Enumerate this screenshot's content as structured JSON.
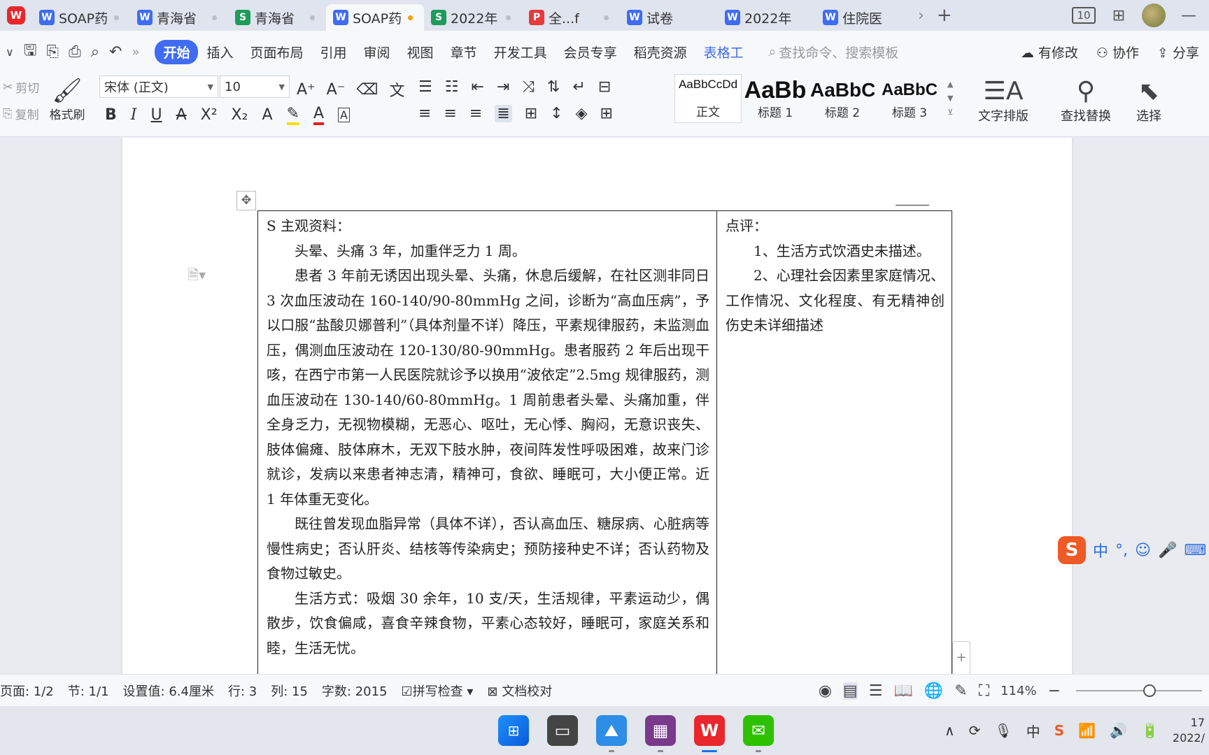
{
  "tabs": [
    {
      "label": "SOAP药",
      "kind": "W",
      "color": "#3f6cf2",
      "active": false
    },
    {
      "label": "青海省",
      "kind": "W",
      "color": "#3f6cf2",
      "active": false
    },
    {
      "label": "青海省",
      "kind": "S",
      "color": "#1d9c5a",
      "active": false
    },
    {
      "label": "SOAP药",
      "kind": "W",
      "color": "#3f6cf2",
      "active": true
    },
    {
      "label": "2022年",
      "kind": "S",
      "color": "#1d9c5a",
      "active": false
    },
    {
      "label": "全...f",
      "kind": "P",
      "color": "#e8393c",
      "active": false
    },
    {
      "label": "试卷",
      "kind": "W",
      "color": "#3f6cf2",
      "active": false
    },
    {
      "label": "2022年",
      "kind": "W",
      "color": "#3f6cf2",
      "active": false
    },
    {
      "label": "住院医",
      "kind": "W",
      "color": "#3f6cf2",
      "active": false
    }
  ],
  "window": {
    "layout_label": "10"
  },
  "menu": {
    "items": [
      "开始",
      "插入",
      "页面布局",
      "引用",
      "审阅",
      "视图",
      "章节",
      "开发工具",
      "会员专享",
      "稻壳资源",
      "表格工"
    ],
    "active": "开始",
    "search_placeholder": "查找命令、搜索模板",
    "modified": "有修改",
    "collab": "协作",
    "share": "分享"
  },
  "ribbon": {
    "cut": "剪切",
    "copy": "复制",
    "format_painter": "格式刷",
    "font_name": "宋体 (正文)",
    "font_size": "10",
    "styles": [
      {
        "preview": "AaBbCcDd",
        "name": "正文"
      },
      {
        "preview": "AaBb",
        "name": "标题 1"
      },
      {
        "preview": "AaBbC",
        "name": "标题 2"
      },
      {
        "preview": "AaBbC",
        "name": "标题 3"
      }
    ],
    "text_layout": "文字排版",
    "find_replace": "查找替换",
    "select": "选择"
  },
  "document": {
    "s_title": "S 主观资料：",
    "main_paragraphs": [
      "头晕、头痛 3 年，加重伴乏力 1 周。",
      "患者 3 年前无诱因出现头晕、头痛，休息后缓解，在社区测非同日 3 次血压波动在 160-140/90-80mmHg 之间，诊断为“高血压病”，予以口服“盐酸贝娜普利”（具体剂量不详）降压，平素规律服药，未监测血压，偶测血压波动在 120-130/80-90mmHg。患者服药 2 年后出现干咳，在西宁市第一人民医院就诊予以换用“波依定”2.5mg 规律服药，测血压波动在 130-140/60-80mmHg。1 周前患者头晕、头痛加重，伴全身乏力，无视物模糊，无恶心、呕吐，无心悸、胸闷，无意识丧失、肢体偏瘫、肢体麻木，无双下肢水肿，夜间阵发性呼吸困难，故来门诊就诊，发病以来患者神志清，精神可，食欲、睡眠可，大小便正常。近 1 年体重无变化。",
      "既往曾发现血脂异常（具体不详），否认高血压、糖尿病、心脏病等慢性病史；否认肝炎、结核等传染病史；预防接种史不详；否认药物及食物过敏史。",
      "生活方式：吸烟 30 余年，10 支/天，生活规律，平素运动少，偶散步，饮食偏咸，喜食辛辣食物，平素心态较好，睡眠可，家庭关系和睦，生活无忧。"
    ],
    "note_title": "点评：",
    "note_paragraphs": [
      "1、生活方式饮酒史未描述。",
      "2、心理社会因素里家庭情况、工作情况、文化程度、有无精神创伤史未详细描述"
    ]
  },
  "ime": {
    "label": "中"
  },
  "status": {
    "page": "页面: 1/2",
    "section": "节: 1/1",
    "setting": "设置值: 6.4厘米",
    "row": "行: 3",
    "col": "列: 15",
    "words": "字数: 2015",
    "spell": "拼写检查",
    "proof": "文档校对",
    "zoom": "114%"
  },
  "taskbar": {
    "clock_time": "17",
    "clock_date": "2022/"
  }
}
